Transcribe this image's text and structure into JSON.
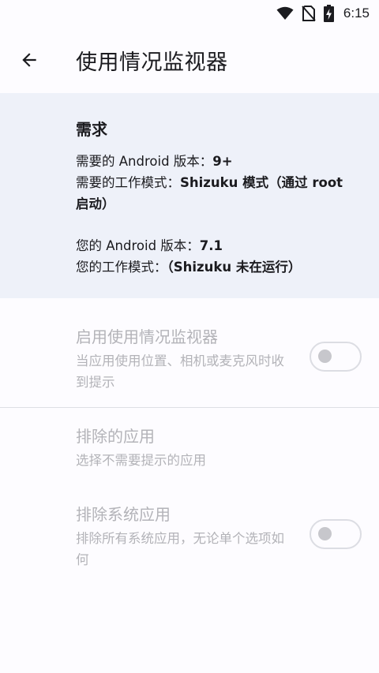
{
  "status_bar": {
    "time": "6:15"
  },
  "app_bar": {
    "title": "使用情况监视器"
  },
  "requirements": {
    "heading": "需求",
    "required_android_label": "需要的 Android 版本：",
    "required_android_value": "9+",
    "required_mode_label": "需要的工作模式：",
    "required_mode_value": "Shizuku 模式（通过 root 启动）",
    "your_android_label": "您的 Android 版本：",
    "your_android_value": "7.1",
    "your_mode_label": "您的工作模式：",
    "your_mode_value": "（Shizuku 未在运行）"
  },
  "prefs": {
    "enable_monitor": {
      "title": "启用使用情况监视器",
      "summary": "当应用使用位置、相机或麦克风时收到提示",
      "checked": false
    },
    "excluded_apps": {
      "title": "排除的应用",
      "summary": "选择不需要提示的应用"
    },
    "exclude_system": {
      "title": "排除系统应用",
      "summary": "排除所有系统应用，无论单个选项如何",
      "checked": false
    }
  },
  "colors": {
    "card_bg": "#eef1f9",
    "disabled_text": "#b3b3b8"
  }
}
